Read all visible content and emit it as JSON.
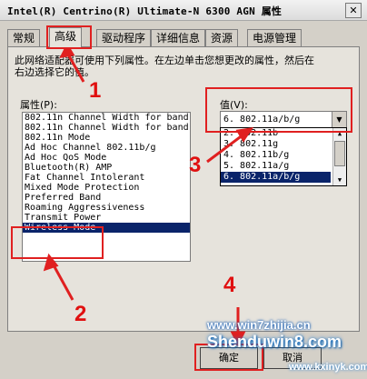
{
  "window": {
    "title": "Intel(R) Centrino(R) Ultimate-N 6300 AGN 属性",
    "close_label": "✕"
  },
  "tabs": [
    {
      "label": "常规"
    },
    {
      "label": "高级"
    },
    {
      "label": "驱动程序"
    },
    {
      "label": "详细信息"
    },
    {
      "label": "资源"
    },
    {
      "label": "电源管理"
    }
  ],
  "active_tab": "高级",
  "description": "此网络适配器可使用下列属性。在左边单击您想更改的属性，然后在右边选择它的值。",
  "property_label": "属性(P):",
  "value_label": "值(V):",
  "properties": [
    {
      "label": "802.11n Channel Width for band"
    },
    {
      "label": "802.11n Channel Width for band"
    },
    {
      "label": "802.11n Mode"
    },
    {
      "label": "Ad Hoc Channel 802.11b/g"
    },
    {
      "label": "Ad Hoc QoS Mode"
    },
    {
      "label": "Bluetooth(R) AMP"
    },
    {
      "label": "Fat Channel Intolerant"
    },
    {
      "label": "Mixed Mode Protection"
    },
    {
      "label": "Preferred Band"
    },
    {
      "label": "Roaming Aggressiveness"
    },
    {
      "label": "Transmit Power"
    },
    {
      "label": "Wireless Mode"
    }
  ],
  "selected_property": "Wireless Mode",
  "value": {
    "selected": "6. 802.11a/b/g",
    "options": [
      {
        "label": "2. 802.11b"
      },
      {
        "label": "3. 802.11g"
      },
      {
        "label": "4. 802.11b/g"
      },
      {
        "label": "5. 802.11a/g"
      },
      {
        "label": "6. 802.11a/b/g"
      }
    ]
  },
  "annotations": [
    {
      "label": "1"
    },
    {
      "label": "2"
    },
    {
      "label": "3"
    },
    {
      "label": "4"
    }
  ],
  "buttons": {
    "ok": "确定",
    "cancel": "取消"
  },
  "watermark": {
    "url": "www.win7zhijia.cn",
    "brand": "Shenduwin8.com",
    "url2": "www.kxinyk.com"
  },
  "colors": {
    "selection": "#0a246a",
    "annotation": "#e02020"
  }
}
